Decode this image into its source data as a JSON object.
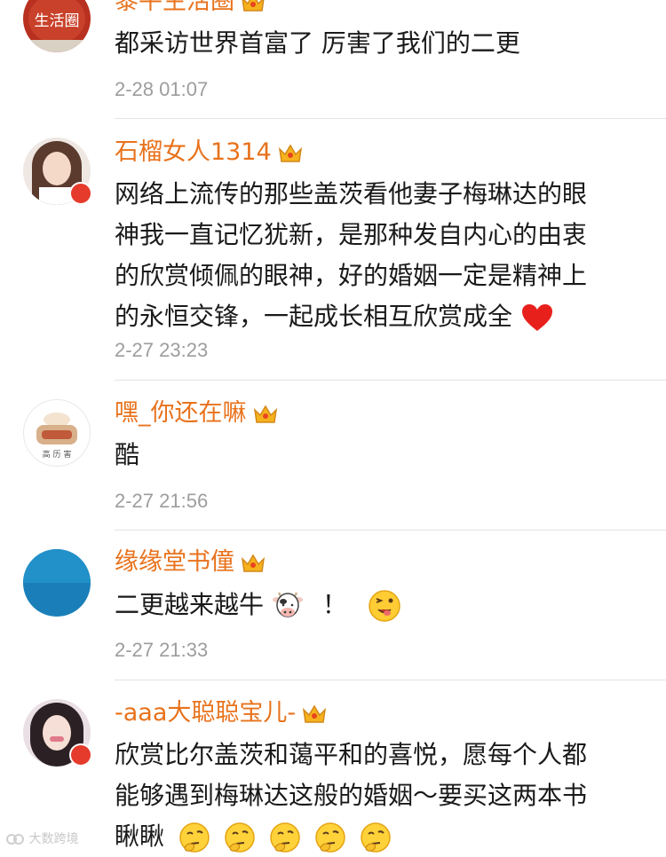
{
  "comments": [
    {
      "username": "黎平生活圈",
      "avatar_text": "生活圈",
      "text": "都采访世界首富了 厉害了我们的二更",
      "time": "2-28 01:07"
    },
    {
      "username": "石榴女人1314",
      "text_lines": [
        "网络上流传的那些盖茨看他妻子梅琳达的眼",
        "神我一直记忆犹新，是那种发自内心的由衷",
        "的欣赏倾佩的眼神，好的婚姻一定是精神上",
        "的永恒交锋，一起成长相互欣赏成全"
      ],
      "time": "2-27 23:23"
    },
    {
      "username": "嘿_你还在嘛",
      "avatar_text": "高 历 害",
      "text": "酷",
      "time": "2-27 21:56"
    },
    {
      "username": "缘缘堂书僮",
      "text": "二更越来越牛",
      "text_suffix": "！",
      "time": "2-27 21:33"
    },
    {
      "username": "-aaa大聪聪宝儿-",
      "text_lines": [
        "欣赏比尔盖茨和蔼平和的喜悦，愿每个人都",
        "能够遇到梅琳达这般的婚姻～要买这两本书",
        "瞅瞅"
      ]
    }
  ],
  "watermark": "大数跨境",
  "colors": {
    "username": "#e8721c",
    "time": "#9d9d9d",
    "text": "#1a1a1a",
    "divider": "#e3e3e3",
    "badge": "#e53b2c"
  },
  "icons": [
    "crown-icon",
    "heart-emoji",
    "cow-emoji",
    "wink-emoji",
    "thinking-emoji",
    "verified-badge-icon"
  ]
}
